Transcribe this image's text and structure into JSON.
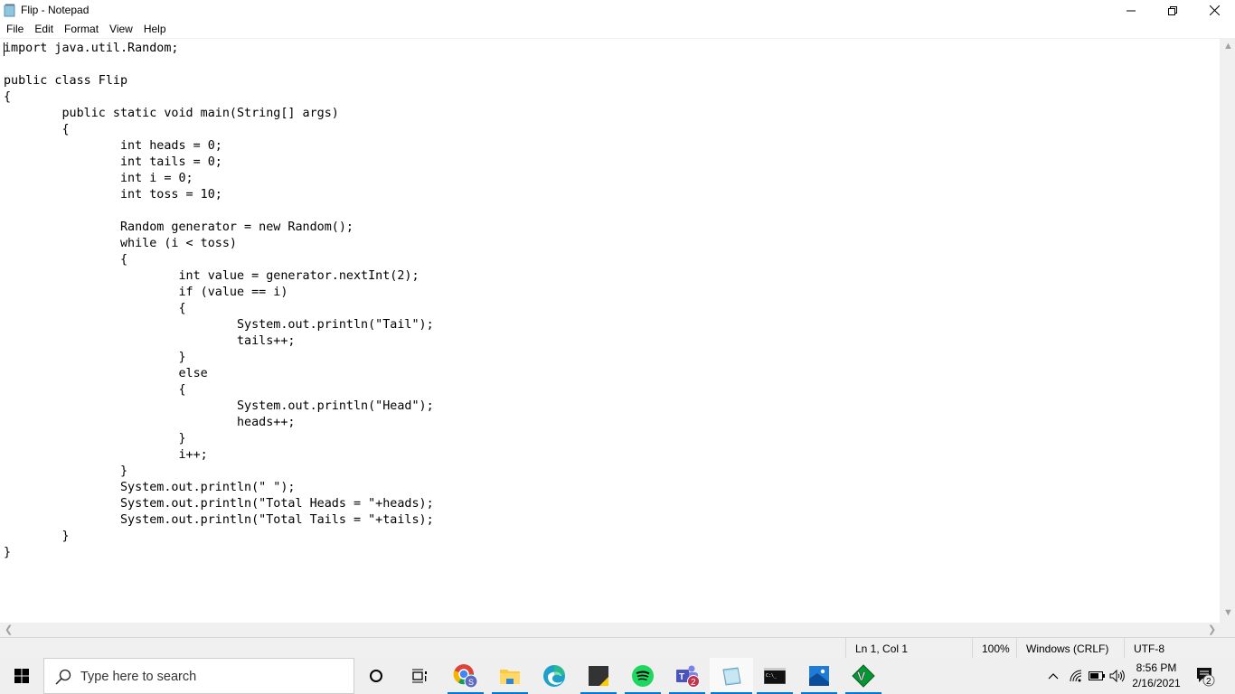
{
  "window": {
    "title": "Flip - Notepad",
    "controls": {
      "minimize": "minimize",
      "restore": "restore",
      "close": "close"
    }
  },
  "menu": [
    "File",
    "Edit",
    "Format",
    "View",
    "Help"
  ],
  "editor": {
    "content": "import java.util.Random;\n\npublic class Flip\n{\n\tpublic static void main(String[] args)\n\t{\n\t\tint heads = 0;\n\t\tint tails = 0;\n\t\tint i = 0;\n\t\tint toss = 10;\n\n\t\tRandom generator = new Random();\n\t\twhile (i < toss)\n\t\t{\n\t\t\tint value = generator.nextInt(2);\n\t\t\tif (value == i)\n\t\t\t{\n\t\t\t\tSystem.out.println(\"Tail\");\n\t\t\t\ttails++;\n\t\t\t}\n\t\t\telse\n\t\t\t{\n\t\t\t\tSystem.out.println(\"Head\");\n\t\t\t\theads++;\n\t\t\t}\n\t\t\ti++;\n\t\t}\n\t\tSystem.out.println(\" \");\n\t\tSystem.out.println(\"Total Heads = \"+heads);\n\t\tSystem.out.println(\"Total Tails = \"+tails);\n\t}\n}"
  },
  "status": {
    "position": "Ln 1, Col 1",
    "zoom": "100%",
    "line_ending": "Windows (CRLF)",
    "encoding": "UTF-8"
  },
  "taskbar": {
    "search_placeholder": "Type here to search",
    "apps": [
      {
        "name": "chrome",
        "running": true
      },
      {
        "name": "file-explorer",
        "running": true
      },
      {
        "name": "edge",
        "running": false
      },
      {
        "name": "sticky-notes",
        "running": true
      },
      {
        "name": "spotify",
        "running": true
      },
      {
        "name": "teams",
        "running": true,
        "badge": "2"
      },
      {
        "name": "notepad",
        "running": true,
        "active": true
      },
      {
        "name": "command-prompt",
        "running": true
      },
      {
        "name": "photos",
        "running": true
      },
      {
        "name": "vim",
        "running": true
      }
    ],
    "time": "8:56 PM",
    "date": "2/16/2021",
    "notifications": "2"
  }
}
